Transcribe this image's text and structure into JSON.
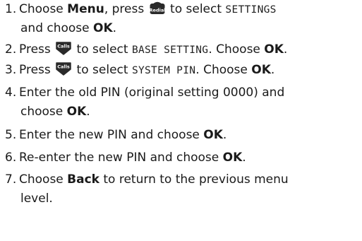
{
  "steps": [
    {
      "number": "1.",
      "t1": "Choose ",
      "b1": "Menu",
      "t2": ", press ",
      "key": "Redial",
      "t3": " to select ",
      "lcd": "SETTINGS",
      "t4": "and choose ",
      "b2": "OK",
      "t5": "."
    },
    {
      "number": "2.",
      "t1": "Press ",
      "key": "Calls",
      "t2": " to select ",
      "lcd": "BASE SETTING",
      "t3": ". Choose ",
      "b1": "OK",
      "t4": "."
    },
    {
      "number": "3.",
      "t1": "Press ",
      "key": "Calls",
      "t2": " to select ",
      "lcd": "SYSTEM PIN",
      "t3": ". Choose ",
      "b1": "OK",
      "t4": "."
    },
    {
      "number": "4.",
      "t1": "Enter the old PIN (original setting 0000) and",
      "t2": "choose ",
      "b1": "OK",
      "t3": "."
    },
    {
      "number": "5.",
      "t1": "Enter the new PIN and choose ",
      "b1": "OK",
      "t2": "."
    },
    {
      "number": "6.",
      "t1": "Re-enter the new PIN and choose ",
      "b1": "OK",
      "t2": "."
    },
    {
      "number": "7.",
      "t1": "Choose ",
      "b1": "Back",
      "t2": " to return to the previous menu",
      "t3": "level."
    }
  ],
  "colors": {
    "text": "#1a1a1a",
    "key_fill": "#2a2a2a",
    "key_text": "#ffffff"
  },
  "icons": {
    "redial_key": "redial-key-icon",
    "calls_key": "calls-down-key-icon"
  }
}
